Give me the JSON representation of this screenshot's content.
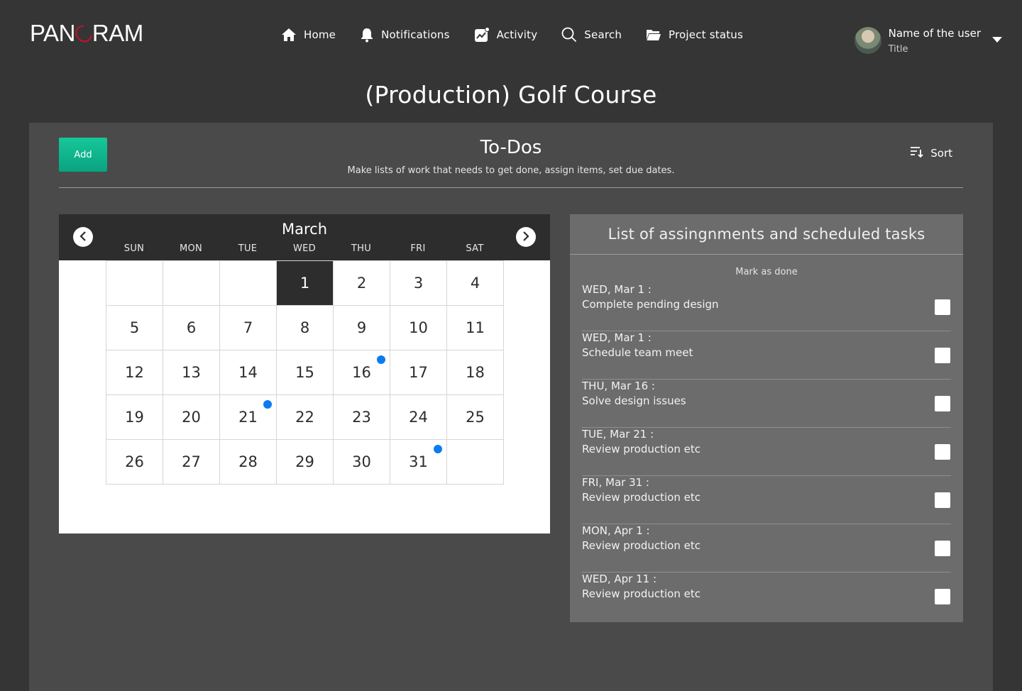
{
  "brand": {
    "logo_text_left": "PAN",
    "logo_text_right": "RAM",
    "accent": "#c8102e"
  },
  "nav": [
    {
      "label": "Home",
      "icon": "home-icon"
    },
    {
      "label": "Notifications",
      "icon": "bell-icon"
    },
    {
      "label": "Activity",
      "icon": "activity-icon"
    },
    {
      "label": "Search",
      "icon": "search-icon"
    },
    {
      "label": "Project status",
      "icon": "folder-icon"
    }
  ],
  "user": {
    "name": "Name of the user",
    "title": "Title"
  },
  "page_title": "(Production) Golf Course",
  "todos": {
    "add_label": "Add",
    "title": "To-Dos",
    "subtitle": "Make lists of work that needs to get done, assign items, set due dates.",
    "sort_label": "Sort",
    "add_color": "#0fb88c"
  },
  "calendar": {
    "month": "March",
    "weekdays": [
      "SUN",
      "MON",
      "TUE",
      "WED",
      "THU",
      "FRI",
      "SAT"
    ],
    "days": [
      "",
      "",
      "",
      "1",
      "2",
      "3",
      "4",
      "5",
      "6",
      "7",
      "8",
      "9",
      "10",
      "11",
      "12",
      "13",
      "14",
      "15",
      "16",
      "17",
      "18",
      "19",
      "20",
      "21",
      "22",
      "23",
      "24",
      "25",
      "26",
      "27",
      "28",
      "29",
      "30",
      "31",
      ""
    ],
    "selected_day": "1",
    "event_days": [
      "16",
      "21",
      "31"
    ],
    "event_color": "#0a7cf0"
  },
  "tasks": {
    "title": "List of assingnments and scheduled tasks",
    "mark_done_label": "Mark as done",
    "items": [
      {
        "date": "WED, Mar 1 :",
        "desc": "Complete pending design",
        "done": false
      },
      {
        "date": "WED, Mar 1 :",
        "desc": "Schedule team meet",
        "done": false
      },
      {
        "date": "THU, Mar 16 :",
        "desc": "Solve design issues",
        "done": false
      },
      {
        "date": "TUE, Mar 21 :",
        "desc": "Review production etc",
        "done": false
      },
      {
        "date": "FRI, Mar 31 :",
        "desc": "Review production etc",
        "done": false
      },
      {
        "date": "MON, Apr 1 :",
        "desc": "Review production etc",
        "done": false
      },
      {
        "date": "WED, Apr 11 :",
        "desc": "Review production etc",
        "done": false
      }
    ]
  }
}
